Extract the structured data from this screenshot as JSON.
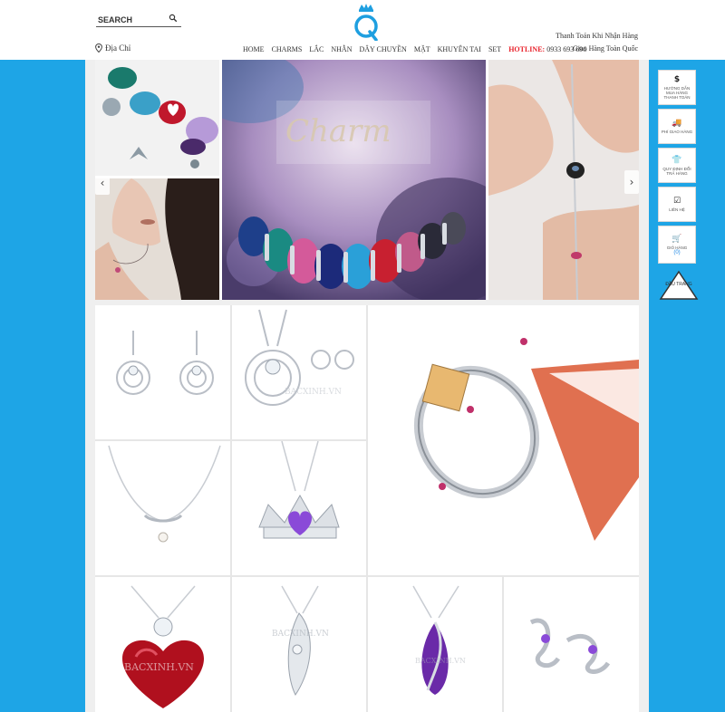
{
  "header": {
    "search_placeholder": "SEARCH",
    "address_label": "Địa Chỉ",
    "nav": {
      "items": [
        "HOME",
        "CHARMS",
        "LẮC",
        "NHẪN",
        "DÂY CHUYỀN",
        "MẶT",
        "KHUYÊN TAI",
        "SET"
      ],
      "hotline_label": "HOTLINE:",
      "hotline_number": "0933 693 696"
    },
    "payment_note": "Thanh Toán Khi Nhận Hàng",
    "shipping_note": "Giao Hàng Toàn Quốc"
  },
  "banner": {
    "title_script": "Charm"
  },
  "products": {
    "watermark": "BACXINH.VN"
  },
  "floating_sidebar": {
    "items": [
      {
        "icon": "dollar-icon",
        "glyph": "$",
        "label": "HƯỚNG DẪN MUA HÀNG THANH TOÁN"
      },
      {
        "icon": "truck-icon",
        "glyph": "🚚",
        "label": "PHÍ GIAO HÀNG"
      },
      {
        "icon": "tshirt-icon",
        "glyph": "👕",
        "label": "QUY ĐỊNH ĐỔI TRẢ HÀNG"
      },
      {
        "icon": "checkbox-icon",
        "glyph": "☑",
        "label": "LIÊN HỆ"
      },
      {
        "icon": "cart-icon",
        "glyph": "🛒",
        "label": "GIỎ HÀNG"
      }
    ],
    "cart_count": "(0)",
    "back_to_top": "ĐẦU TRANG"
  },
  "colors": {
    "side_blue": "#1ea5e6",
    "hotline_red": "#e8212a",
    "logo_blue": "#1e9fe0"
  }
}
